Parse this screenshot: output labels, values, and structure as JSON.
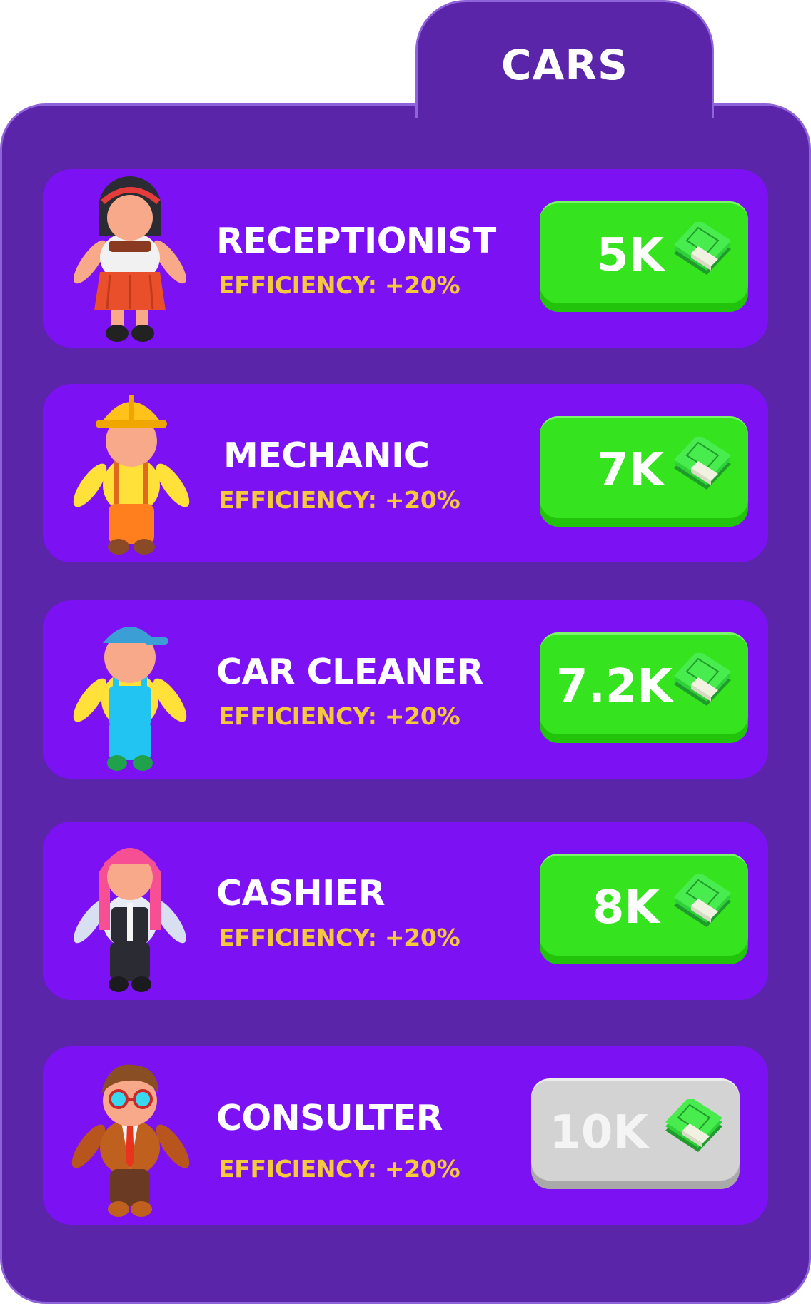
{
  "panel": {
    "tab_title": "CARS"
  },
  "workers": [
    {
      "name": "RECEPTIONIST",
      "efficiency": "EFFICIENCY: +20%",
      "price": "5K",
      "locked": false
    },
    {
      "name": "MECHANIC",
      "efficiency": "EFFICIENCY: +20%",
      "price": "7K",
      "locked": false
    },
    {
      "name": "CAR CLEANER",
      "efficiency": "EFFICIENCY: +20%",
      "price": "7.2K",
      "locked": false
    },
    {
      "name": "CASHIER",
      "efficiency": "EFFICIENCY: +20%",
      "price": "8K",
      "locked": false
    },
    {
      "name": "CONSULTER",
      "efficiency": "EFFICIENCY: +20%",
      "price": "10K",
      "locked": true
    }
  ],
  "colors": {
    "panel_bg": "#5a25a8",
    "row_bg": "#7c12f4",
    "efficiency_text": "#f4c93e",
    "buy_button": "#36e31f",
    "locked_button": "#d3d3d3"
  },
  "icons": {
    "cash": "cash-stack-icon",
    "characters": [
      "receptionist-icon",
      "mechanic-icon",
      "car-cleaner-icon",
      "cashier-icon",
      "consulter-icon"
    ]
  }
}
